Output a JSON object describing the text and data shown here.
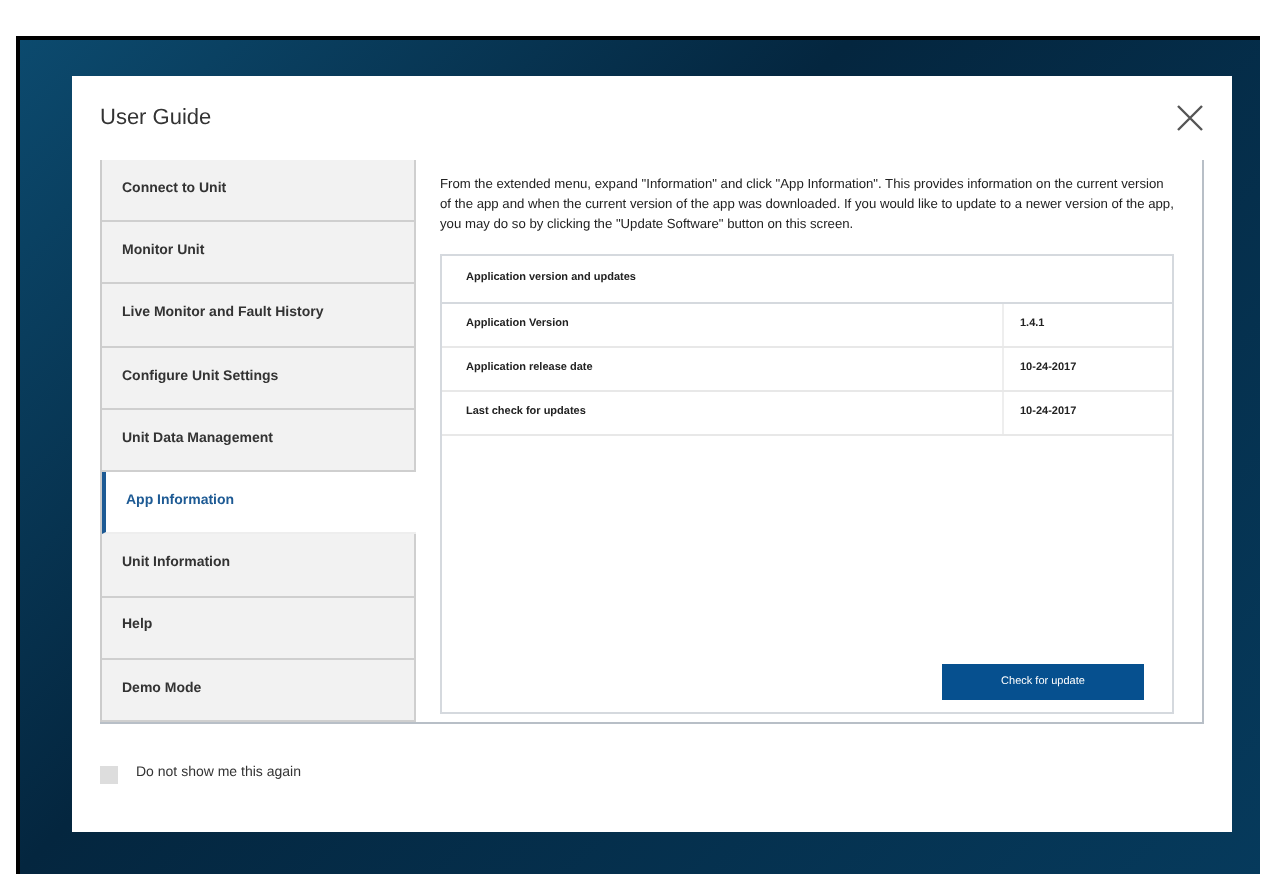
{
  "dialog": {
    "title": "User Guide"
  },
  "sidebar": {
    "items": [
      {
        "label": "Connect to Unit",
        "selected": false
      },
      {
        "label": "Monitor Unit",
        "selected": false
      },
      {
        "label": "Live Monitor and Fault History",
        "selected": false
      },
      {
        "label": "Configure Unit Settings",
        "selected": false
      },
      {
        "label": "Unit Data Management",
        "selected": false
      },
      {
        "label": "App Information",
        "selected": true
      },
      {
        "label": "Unit Information",
        "selected": false
      },
      {
        "label": "Help",
        "selected": false
      },
      {
        "label": "Demo Mode",
        "selected": false
      }
    ]
  },
  "content": {
    "description": "From the extended menu, expand \"Information\" and click \"App Information\". This provides information on the current version of the app and when the current version of the app was downloaded. If you would like to update to a newer version of the app, you may do so by clicking the \"Update Software\" button on this screen.",
    "table": {
      "title": "Application version and updates",
      "rows": [
        {
          "label": "Application Version",
          "value": "1.4.1"
        },
        {
          "label": "Application release date",
          "value": "10-24-2017"
        },
        {
          "label": "Last check for updates",
          "value": "10-24-2017"
        }
      ]
    },
    "button": "Check for update"
  },
  "footer": {
    "checkbox": {
      "label": "Do not show me this again",
      "checked": false
    }
  }
}
